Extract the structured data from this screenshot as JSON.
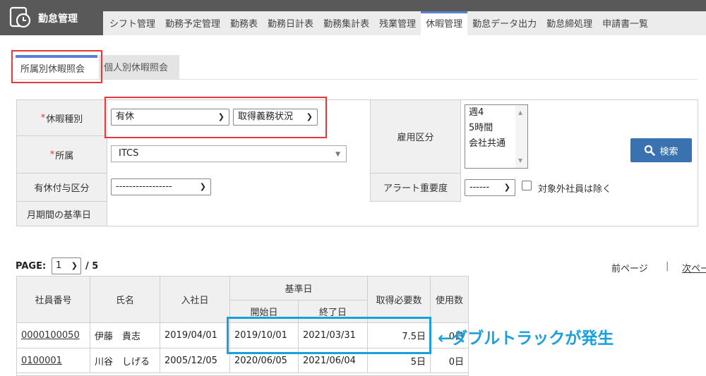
{
  "header": {
    "title": "勤怠管理",
    "menu": [
      {
        "label": "シフト管理"
      },
      {
        "label": "勤務予定管理"
      },
      {
        "label": "勤務表"
      },
      {
        "label": "勤務日計表"
      },
      {
        "label": "勤務集計表"
      },
      {
        "label": "残業管理"
      },
      {
        "label": "休暇管理",
        "active": true
      },
      {
        "label": "勤怠データ出力"
      },
      {
        "label": "勤怠締処理"
      },
      {
        "label": "申請書一覧"
      }
    ]
  },
  "subtabs": {
    "active": "所属別休暇照会",
    "inactive": "個人別休暇照会"
  },
  "form": {
    "required_mark": "*",
    "leave_type_label": "休暇種別",
    "leave_type_value": "有休",
    "leave_mode_value": "取得義務状況",
    "dept_label": "所属",
    "dept_value": "ITCS",
    "grant_label": "有休付与区分",
    "grant_value": "-----------------",
    "base_date_label": "月期間の基準日",
    "employment_label": "雇用区分",
    "employment_options": [
      "週4",
      "5時間",
      "会社共通"
    ],
    "alert_label": "アラート重要度",
    "alert_value": "------",
    "exclude_label": "対象外社員は除く",
    "search_label": "検索"
  },
  "paging": {
    "label": "PAGE:",
    "current": "1",
    "total": "/ 5",
    "prev": "前ページ",
    "separator": "|",
    "next": "次ペー"
  },
  "table": {
    "headers": {
      "emp_no": "社員番号",
      "name": "氏名",
      "join_date": "入社日",
      "base_date": "基準日",
      "start": "開始日",
      "end": "終了日",
      "required": "取得必要数",
      "used": "使用数"
    },
    "rows": [
      {
        "emp_no": "0000100050",
        "name": "伊藤　貴志",
        "join": "2019/04/01",
        "start": "2019/10/01",
        "end": "2021/03/31",
        "required": "7.5日",
        "used": "0日"
      },
      {
        "emp_no": "0100001",
        "name": "川谷　しげる",
        "join": "2005/12/05",
        "start": "2020/06/05",
        "end": "2021/06/04",
        "required": "5日",
        "used": "0日"
      }
    ]
  },
  "annotation": "←ダブルトラックが発生",
  "colors": {
    "header_bg": "#595959",
    "accent": "#5b7fd6",
    "highlight_red": "#e5383b",
    "highlight_blue": "#1aa0dc",
    "button": "#3a72b0"
  }
}
